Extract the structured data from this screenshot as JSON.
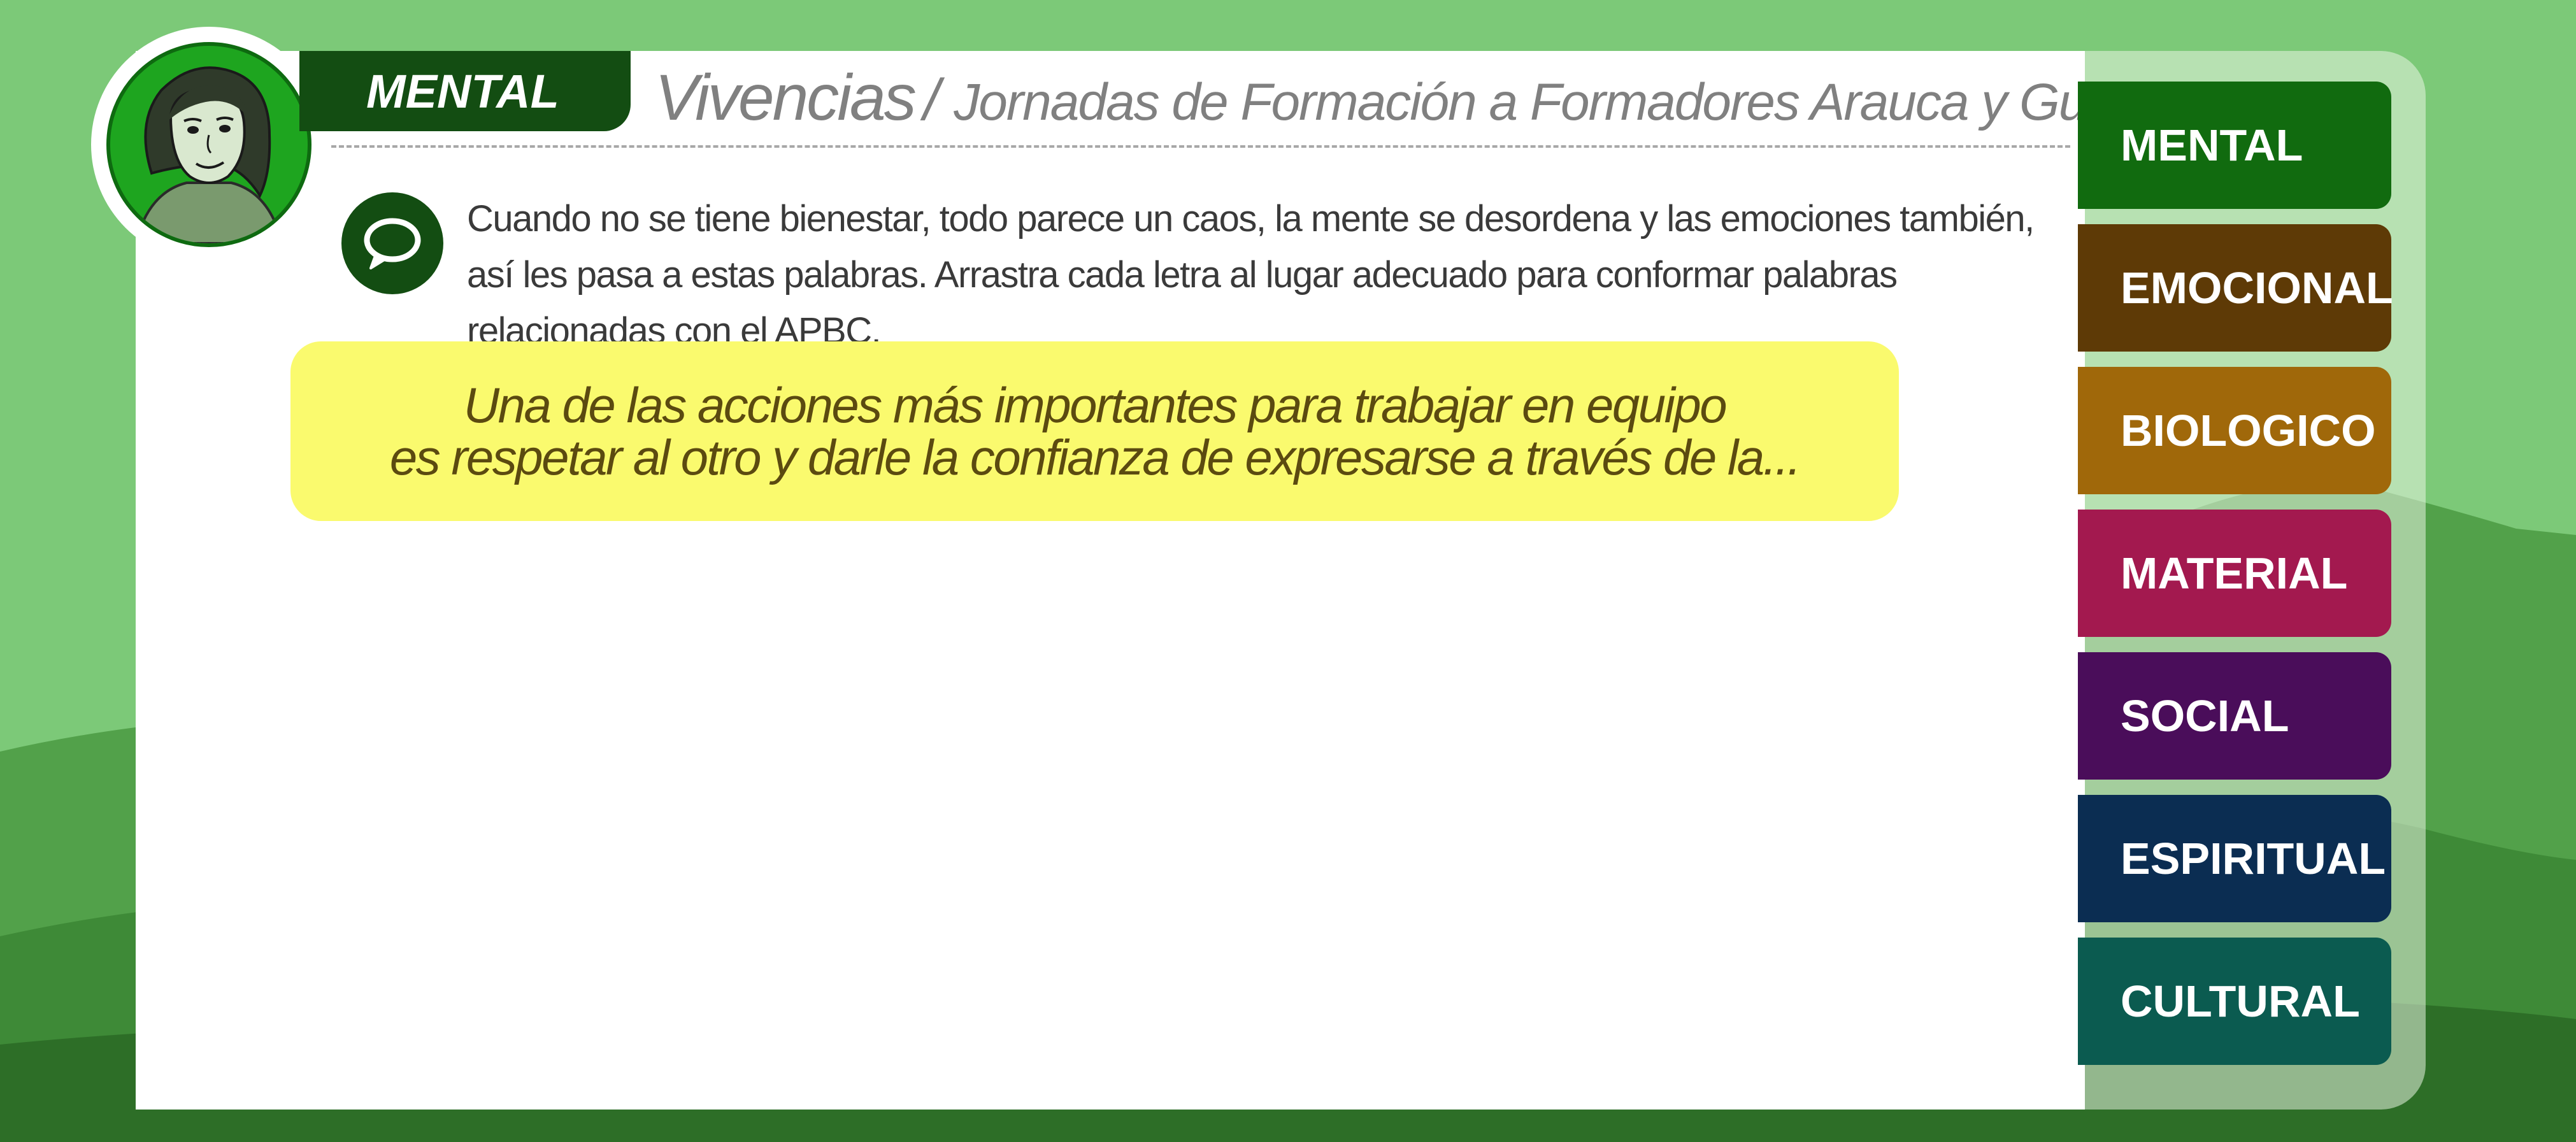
{
  "header": {
    "category_tab": "MENTAL",
    "title_main": "Vivencias",
    "title_separator": "/",
    "title_sub": "Jornadas de Formación a Formadores Arauca y Guaviare"
  },
  "instruction": {
    "icon": "chat-bubble-icon",
    "text": "Cuando no se tiene bienestar, todo parece un caos, la mente se desordena y las emociones también, así les pasa a estas palabras. Arrastra cada letra al lugar adecuado para conformar palabras relacionadas con el APBC."
  },
  "quote": {
    "line1": "Una de las acciones más importantes para trabajar en equipo",
    "line2": "es respetar al otro y darle la confianza de expresarse a través de la..."
  },
  "sidebar": {
    "items": [
      {
        "label": "MENTAL",
        "color": "#116b0f"
      },
      {
        "label": "EMOCIONAL",
        "color": "#5e3a06"
      },
      {
        "label": "BIOLOGICO",
        "color": "#a0680a"
      },
      {
        "label": "MATERIAL",
        "color": "#a3194f"
      },
      {
        "label": "SOCIAL",
        "color": "#4a0d5a"
      },
      {
        "label": "ESPIRITUAL",
        "color": "#0b2d52"
      },
      {
        "label": "CULTURAL",
        "color": "#0b5b50"
      }
    ]
  },
  "colors": {
    "background": "#7cc978",
    "dark_green": "#134d12",
    "quote_bg": "#fafa6e",
    "quote_text": "#5b4a10"
  },
  "avatar": {
    "icon": "character-avatar-icon"
  }
}
